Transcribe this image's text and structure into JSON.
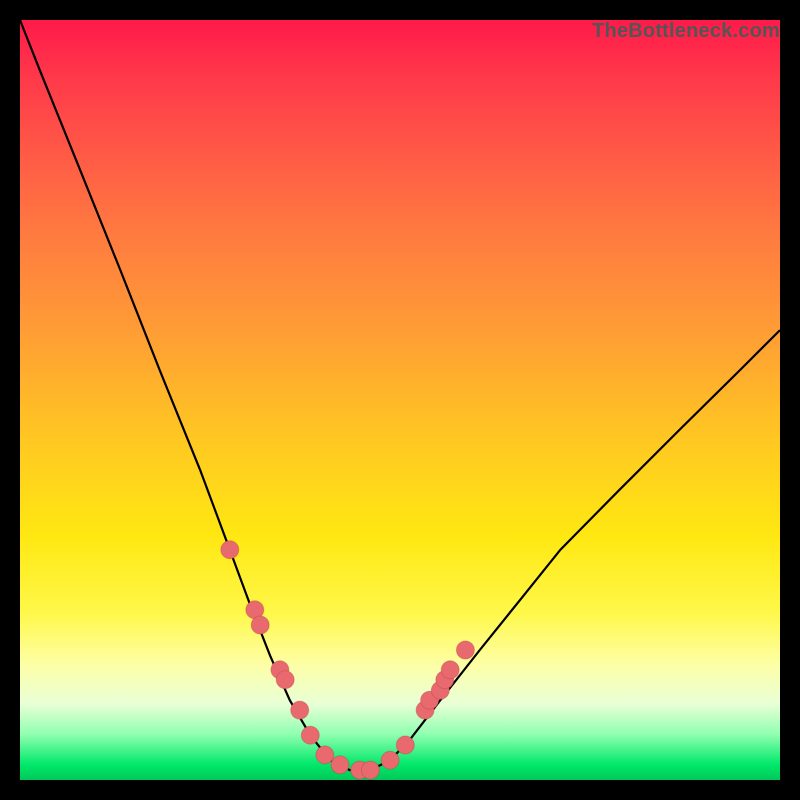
{
  "watermark": "TheBottleneck.com",
  "colors": {
    "frame": "#000000",
    "curve": "#000000",
    "marker": "#e86a6f",
    "gradient_top": "#ff1a4a",
    "gradient_bottom": "#00c858"
  },
  "chart_data": {
    "type": "line",
    "title": "",
    "xlabel": "",
    "ylabel": "",
    "xlim": [
      0,
      100
    ],
    "ylim": [
      0,
      100
    ],
    "grid": false,
    "legend": false,
    "description": "V-shaped bottleneck curve on a vertical rainbow gradient (red=bad at top, green=good at bottom). The curve falls steeply from top-left, flattens to near-zero around x≈40-48, then rises to the right edge at ~60% height. Pinkish markers cluster where the curve is in the yellow/green band near the trough.",
    "series": [
      {
        "name": "bottleneck-curve",
        "x": [
          0,
          2.6,
          7.9,
          13.2,
          18.4,
          23.7,
          27.6,
          30.3,
          32.9,
          35.5,
          38.2,
          40.8,
          43.4,
          46.1,
          48.7,
          51.3,
          55.3,
          60.5,
          65.8,
          71.1,
          78.9,
          86.8,
          94.7,
          100
        ],
        "y": [
          100,
          93.4,
          80.3,
          67.1,
          53.9,
          40.8,
          30.3,
          23.0,
          16.4,
          10.5,
          5.9,
          2.6,
          1.3,
          1.3,
          2.6,
          5.3,
          10.5,
          17.1,
          23.7,
          30.3,
          38.2,
          46.1,
          53.9,
          59.2
        ]
      }
    ],
    "markers": {
      "name": "highlight-points",
      "color": "#e86a6f",
      "x": [
        27.6,
        30.9,
        31.6,
        34.2,
        34.9,
        36.8,
        38.2,
        40.1,
        42.1,
        44.7,
        46.1,
        48.7,
        50.7,
        53.3,
        53.9,
        55.3,
        55.9,
        56.6,
        58.6
      ],
      "y": [
        30.3,
        22.4,
        20.4,
        14.5,
        13.2,
        9.2,
        5.9,
        3.3,
        2.0,
        1.3,
        1.3,
        2.6,
        4.6,
        9.2,
        10.5,
        11.8,
        13.2,
        14.5,
        17.1
      ]
    }
  }
}
